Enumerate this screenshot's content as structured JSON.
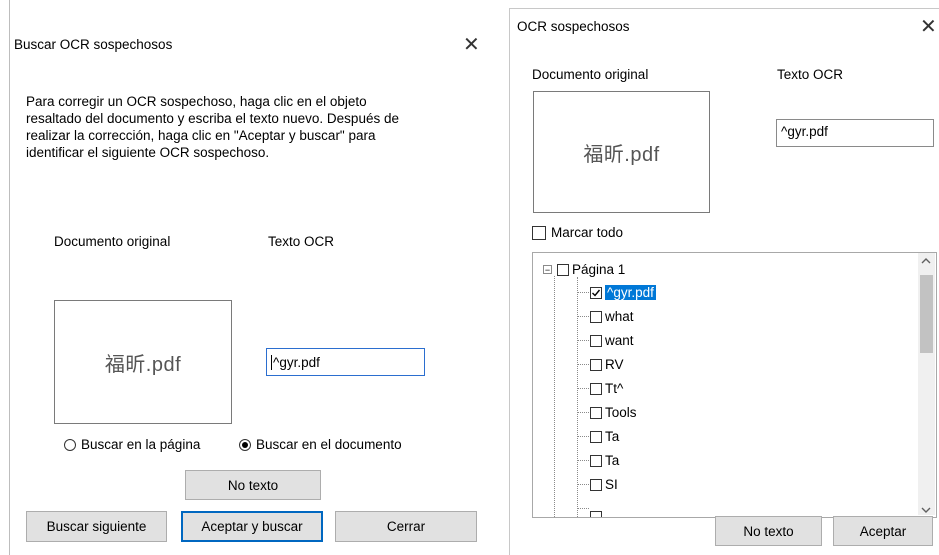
{
  "left_dialog": {
    "title": "Buscar OCR sospechosos",
    "instructions": [
      "Para corregir un OCR sospechoso, haga clic en el objeto",
      "resaltado del documento y escriba el texto nuevo. Después de",
      "realizar la corrección, haga clic en \"Aceptar y buscar\" para",
      "identificar el siguiente OCR sospechoso."
    ],
    "original_label": "Documento original",
    "ocr_label": "Texto OCR",
    "image_text": "福昕.pdf",
    "ocr_value": "^gyr.pdf",
    "radio_page": "Buscar en la página",
    "radio_document": "Buscar en el documento",
    "no_text_button": "No texto",
    "find_next_button": "Buscar siguiente",
    "accept_find_button": "Aceptar y buscar",
    "close_button": "Cerrar"
  },
  "right_dialog": {
    "title": "OCR sospechosos",
    "original_label": "Documento original",
    "ocr_label": "Texto OCR",
    "image_text": "福昕.pdf",
    "ocr_value": "^gyr.pdf",
    "select_all": "Marcar todo",
    "tree": {
      "page": "Página 1",
      "items": [
        "^gyr.pdf",
        "what",
        "want",
        "RV",
        "Tt^",
        "Tools",
        "Ta",
        "Ta",
        "SI"
      ]
    },
    "no_text_button": "No texto",
    "accept_button": "Aceptar"
  },
  "icons": {
    "close": "close-icon",
    "check": "checkmark-icon",
    "tree_collapse": "minus-box-icon",
    "scroll_up": "chevron-up-icon",
    "scroll_down": "chevron-down-icon"
  },
  "colors": {
    "selection": "#0078d7",
    "focus_border": "#0067c0",
    "button_bg": "#e1e1e1"
  }
}
